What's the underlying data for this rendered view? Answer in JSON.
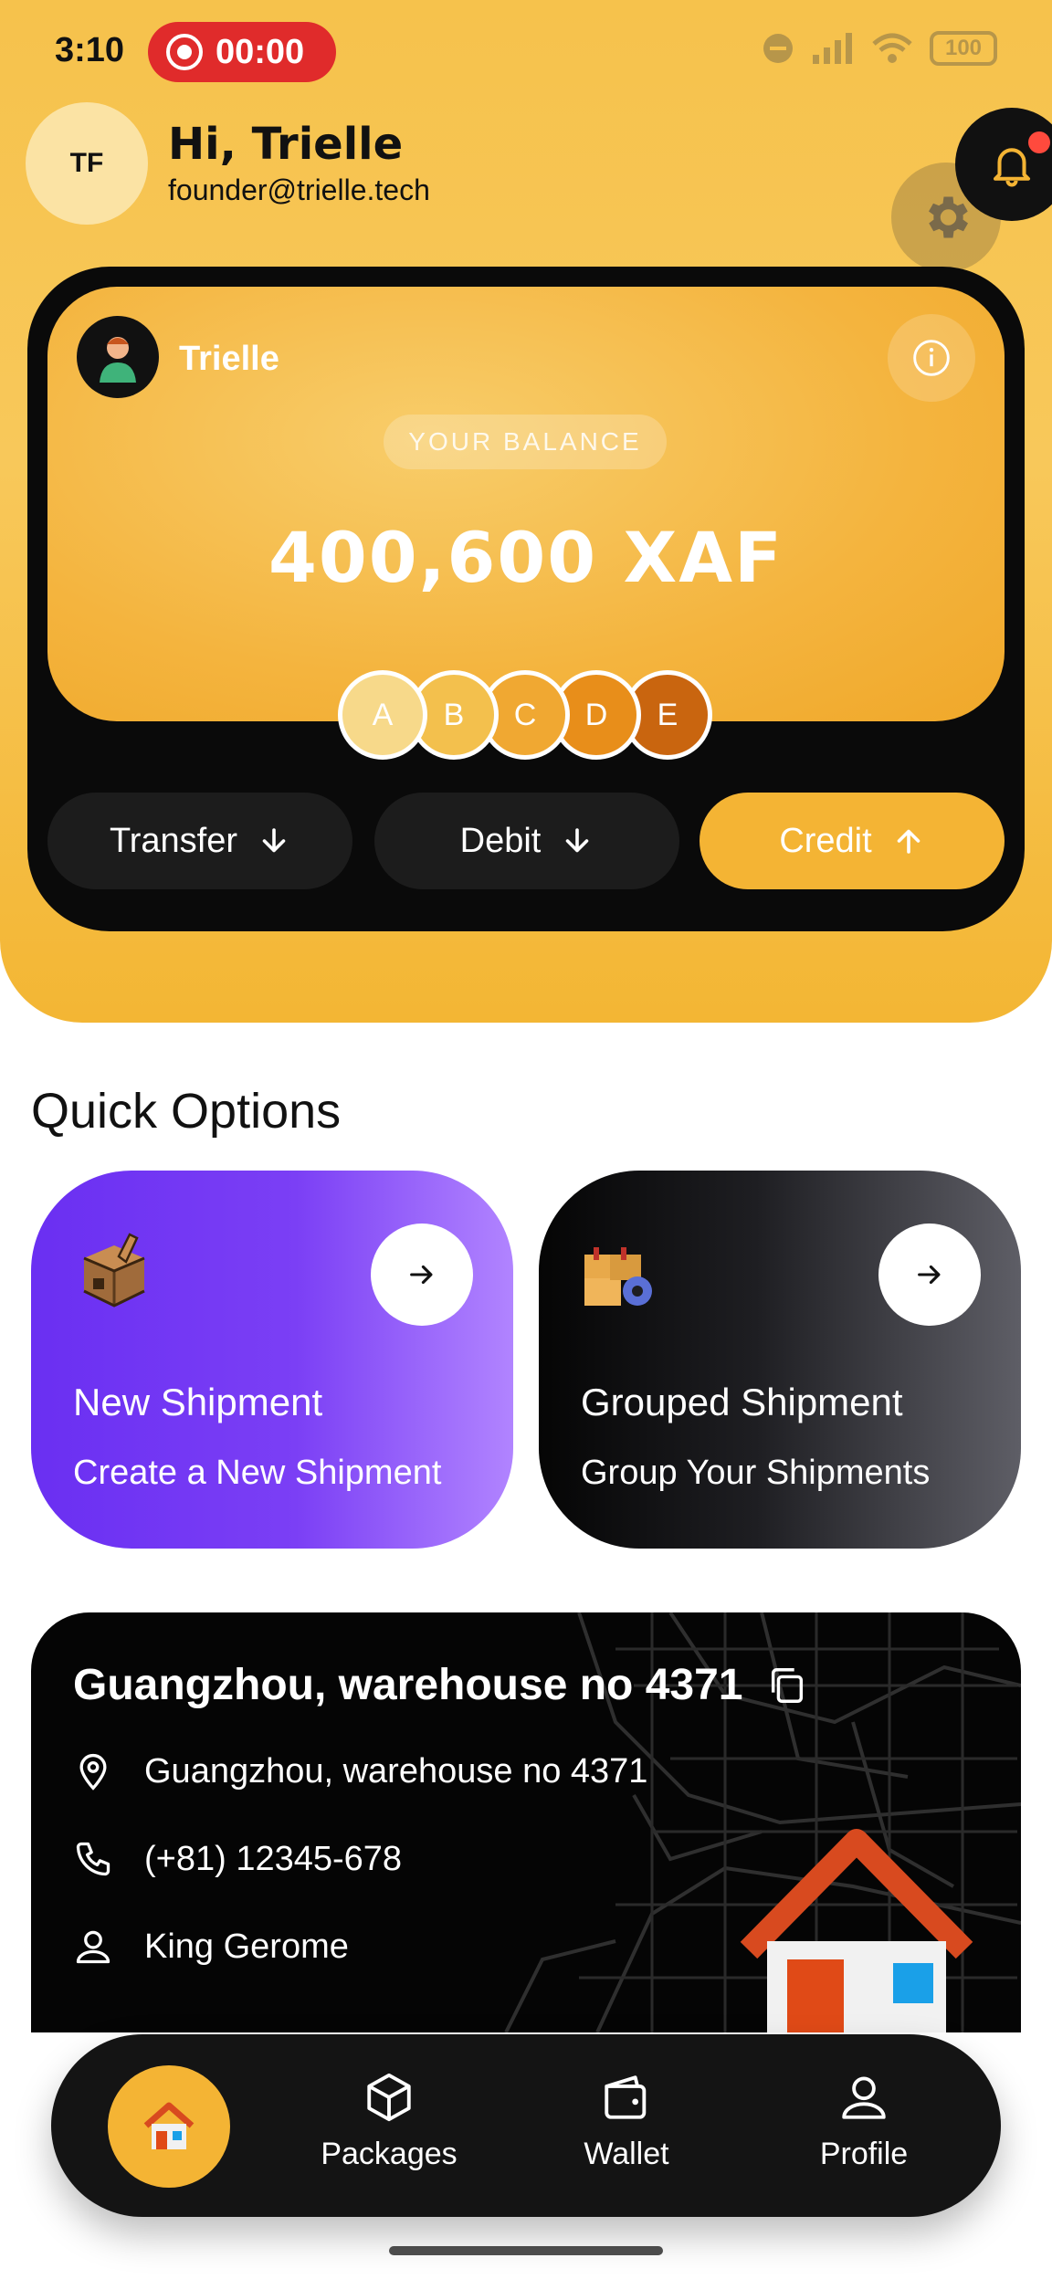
{
  "status_bar": {
    "time": "3:10",
    "recording_time": "00:00",
    "battery": "100"
  },
  "header": {
    "avatar_initials": "TF",
    "greeting": "Hi, Trielle",
    "email": "founder@trielle.tech",
    "notification_dot_color": "#ff4a3d"
  },
  "balance_card": {
    "account_name": "Trielle",
    "label": "YOUR BALANCE",
    "amount": "400,600 XAF",
    "tiers": [
      {
        "letter": "A",
        "color": "#f7d98a"
      },
      {
        "letter": "B",
        "color": "#f3c04d"
      },
      {
        "letter": "C",
        "color": "#f0a832"
      },
      {
        "letter": "D",
        "color": "#e88e1a"
      },
      {
        "letter": "E",
        "color": "#c9650f"
      }
    ],
    "actions": {
      "transfer": "Transfer",
      "debit": "Debit",
      "credit": "Credit"
    }
  },
  "quick_options": {
    "title": "Quick Options",
    "cards": [
      {
        "name": "New Shipment",
        "subtitle": "Create a New Shipment",
        "icon": "package-box-icon"
      },
      {
        "name": "Grouped Shipment",
        "subtitle": "Group Your Shipments",
        "icon": "boxes-gear-icon"
      }
    ]
  },
  "warehouse": {
    "title": "Guangzhou, warehouse no 4371",
    "address": "Guangzhou, warehouse no 4371",
    "phone": "(+81) 12345-678",
    "contact": "King Gerome"
  },
  "nav": {
    "packages": "Packages",
    "wallet": "Wallet",
    "profile": "Profile"
  },
  "colors": {
    "accent": "#f4b434",
    "purple": "#7b3ff5",
    "dark": "#111111"
  }
}
